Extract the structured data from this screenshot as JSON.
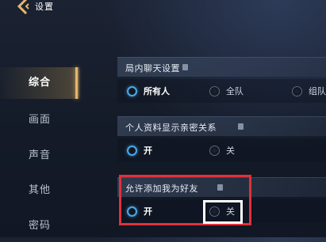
{
  "header": {
    "title": "设置"
  },
  "sidebar": {
    "items": [
      {
        "label": "综合",
        "active": true
      },
      {
        "label": "画面",
        "active": false
      },
      {
        "label": "声音",
        "active": false
      },
      {
        "label": "其他",
        "active": false
      },
      {
        "label": "密码",
        "active": false
      }
    ]
  },
  "settings": {
    "chat": {
      "title": "局内聊天设置",
      "options": [
        {
          "label": "所有人",
          "selected": true
        },
        {
          "label": "全队",
          "selected": false
        },
        {
          "label": "组队",
          "selected": false
        }
      ]
    },
    "profile": {
      "title": "个人资料显示亲密关系",
      "options": [
        {
          "label": "开",
          "selected": true
        },
        {
          "label": "关",
          "selected": false
        }
      ]
    },
    "friend": {
      "title": "允许添加我为好友",
      "options": [
        {
          "label": "开",
          "selected": true
        },
        {
          "label": "关",
          "selected": false
        }
      ]
    }
  },
  "colors": {
    "accent_gold": "#e3b76a",
    "radio_selected": "#4aa9e6",
    "highlight_red": "#e0313b",
    "highlight_white": "#ffffff"
  },
  "icons": {
    "back": "chevron-left-icon",
    "info": "info-icon"
  }
}
